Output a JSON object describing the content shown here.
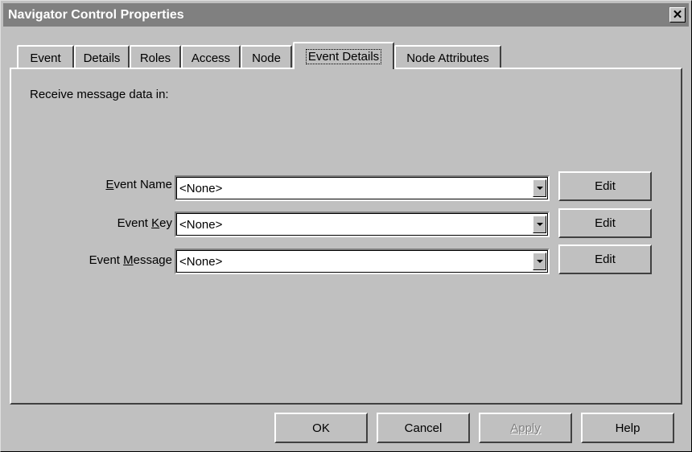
{
  "window": {
    "title": "Navigator Control Properties",
    "close_glyph": "✕"
  },
  "tabs": [
    {
      "label": "Event",
      "active": false
    },
    {
      "label": "Details",
      "active": false
    },
    {
      "label": "Roles",
      "active": false
    },
    {
      "label": "Access",
      "active": false
    },
    {
      "label": "Node",
      "active": false
    },
    {
      "label": "Event Details",
      "active": true
    },
    {
      "label": "Node Attributes",
      "active": false
    }
  ],
  "panel": {
    "intro": "Receive message data in:",
    "fields": [
      {
        "label_pre": "",
        "label_mnemonic": "E",
        "label_post": "vent Name",
        "value": "<None>",
        "edit_label": "Edit"
      },
      {
        "label_pre": "Event ",
        "label_mnemonic": "K",
        "label_post": "ey",
        "value": "<None>",
        "edit_label": "Edit"
      },
      {
        "label_pre": "Event ",
        "label_mnemonic": "M",
        "label_post": "essage",
        "value": "<None>",
        "edit_label": "Edit"
      }
    ]
  },
  "footer": {
    "ok": "OK",
    "cancel": "Cancel",
    "apply": "Apply",
    "apply_enabled": false,
    "help": "Help"
  },
  "icons": {
    "close": "close-icon",
    "dropdown": "chevron-down-icon"
  }
}
